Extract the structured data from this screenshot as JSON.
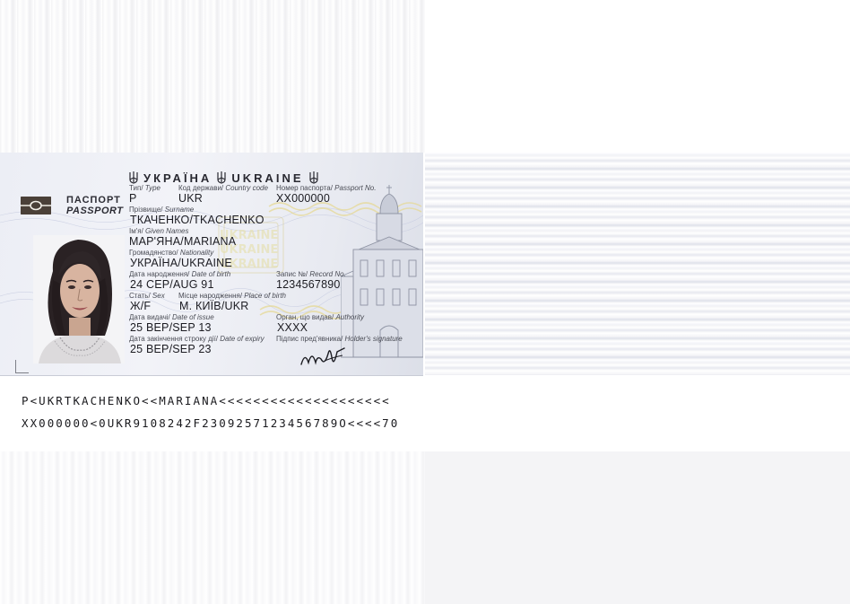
{
  "document": {
    "header_ua": "УКРАЇНА",
    "header_en": "UKRAINE",
    "doc_type_ua": "ПАСПОРТ",
    "doc_type_en": "PASSPORT"
  },
  "fields": {
    "type": {
      "label_ua": "Тип/",
      "label_en": "Type",
      "value": "P"
    },
    "country_code": {
      "label_ua": "Код держави/",
      "label_en": "Country code",
      "value": "UKR"
    },
    "passport_no": {
      "label_ua": "Номер паспорта/",
      "label_en": "Passport No.",
      "value": "XX000000"
    },
    "surname": {
      "label_ua": "Прізвище/",
      "label_en": "Surname",
      "value": "ТКАЧЕНКО/TKACHENKO"
    },
    "given_names": {
      "label_ua": "Ім'я/",
      "label_en": "Given Names",
      "value": "МАР'ЯНА/MARIANA"
    },
    "nationality": {
      "label_ua": "Громадянство/",
      "label_en": "Nationality",
      "value": "УКРАЇНА/UKRAINE"
    },
    "date_of_birth": {
      "label_ua": "Дата народження/",
      "label_en": "Date of birth",
      "value": "24 СЕР/AUG 91"
    },
    "record_no": {
      "label_ua": "Запис №/",
      "label_en": "Record No.",
      "value": "1234567890"
    },
    "sex": {
      "label_ua": "Стать/",
      "label_en": "Sex",
      "value": "Ж/F"
    },
    "place_of_birth": {
      "label_ua": "Місце народження/",
      "label_en": "Place of birth",
      "value": "М. КИЇВ/UKR"
    },
    "date_of_issue": {
      "label_ua": "Дата видачі/",
      "label_en": "Date of issue",
      "value": "25 ВЕР/SEP 13"
    },
    "authority": {
      "label_ua": "Орган, що видав/",
      "label_en": "Authority",
      "value": "XXXX"
    },
    "date_of_expiry": {
      "label_ua": "Дата закінчення строку дії/",
      "label_en": "Date of expiry",
      "value": "25 ВЕР/SEP 23"
    },
    "holder_signature": {
      "label_ua": "Підпис пред'явника/",
      "label_en": "Holder's signature"
    }
  },
  "mrz": {
    "line1": "P<UKRTKACHENKO<<MARIANA<<<<<<<<<<<<<<<<<<<<",
    "line2": "XX000000<0UKR9108242F2309257123456789O<<<<70"
  },
  "icons": {
    "emblem": "trident-icon",
    "chip": "biometric-chip-icon"
  }
}
